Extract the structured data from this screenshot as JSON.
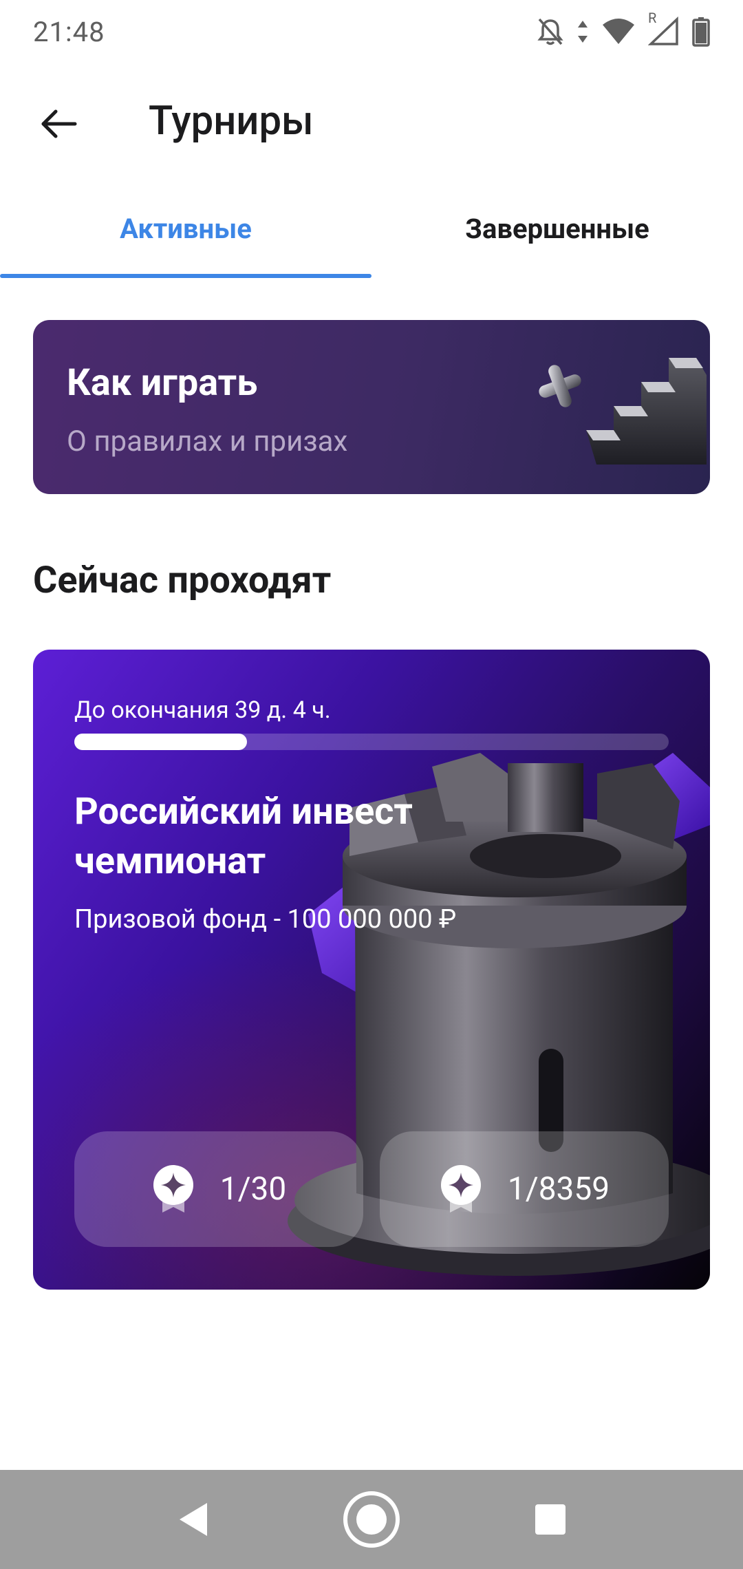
{
  "status_bar": {
    "time": "21:48",
    "roaming": "R"
  },
  "app_bar": {
    "title": "Турниры"
  },
  "tabs": [
    {
      "label": "Активные",
      "active": true
    },
    {
      "label": "Завершенные",
      "active": false
    }
  ],
  "howto": {
    "title": "Как играть",
    "subtitle": "О правилах и призах"
  },
  "section": {
    "title": "Сейчас проходят"
  },
  "tournament": {
    "deadline": "До окончания 39 д. 4 ч.",
    "progress": 0.29,
    "title": "Российский инвест чемпионат",
    "prize": "Призовой фонд - 100 000 000 ₽",
    "stats": [
      {
        "icon": "medal-icon",
        "value": "1/30"
      },
      {
        "icon": "medal-icon",
        "value": "1/8359"
      }
    ]
  },
  "colors": {
    "accent": "#3d86e6",
    "nav_bar": "#9e9e9e"
  }
}
